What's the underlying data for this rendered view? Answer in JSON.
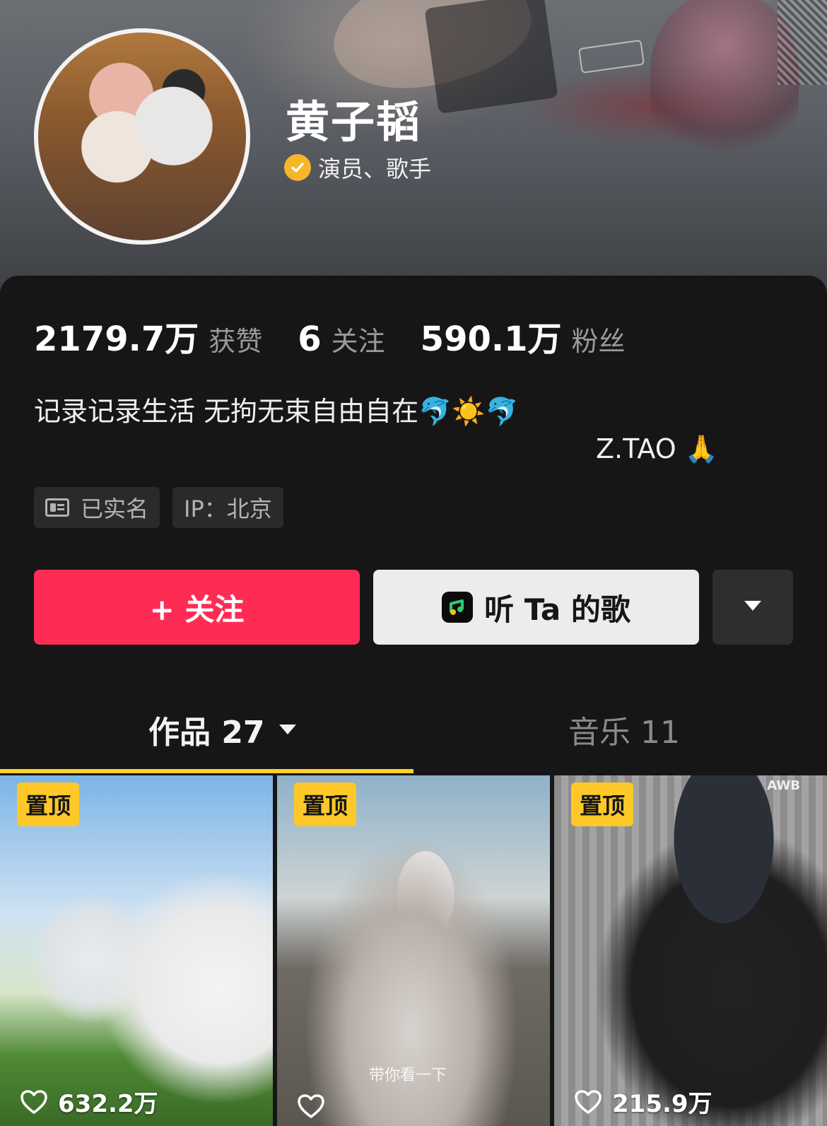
{
  "profile": {
    "name": "黄子韬",
    "verification": "演员、歌手"
  },
  "stats": [
    {
      "value": "2179.7万",
      "label": "获赞"
    },
    {
      "value": "6",
      "label": "关注"
    },
    {
      "value": "590.1万",
      "label": "粉丝"
    }
  ],
  "bio": {
    "line1": "记录记录生活 无拘无束自由自在🐬☀️🐬",
    "line2": "Z.TAO 🙏"
  },
  "tags": {
    "real_name": "已实名",
    "ip": "IP：北京"
  },
  "actions": {
    "follow": "+ 关注",
    "listen": "听 Ta 的歌"
  },
  "tabs": {
    "works": "作品 27",
    "music": "音乐 11"
  },
  "videos": [
    {
      "pinned": "置顶",
      "likes": "632.2万"
    },
    {
      "pinned": "置顶",
      "likes": "",
      "caption": "带你看一下"
    },
    {
      "pinned": "置顶",
      "likes": "215.9万",
      "watermark": "AWB"
    }
  ],
  "colors": {
    "follow_button": "#fe2c55",
    "tab_underline": "#fdd226",
    "pin_badge": "#fdc828",
    "verify_badge": "#f5b62a"
  },
  "icons": [
    "verified-badge-icon",
    "id-card-icon",
    "music-app-icon",
    "dropdown-arrow-icon",
    "heart-icon"
  ]
}
